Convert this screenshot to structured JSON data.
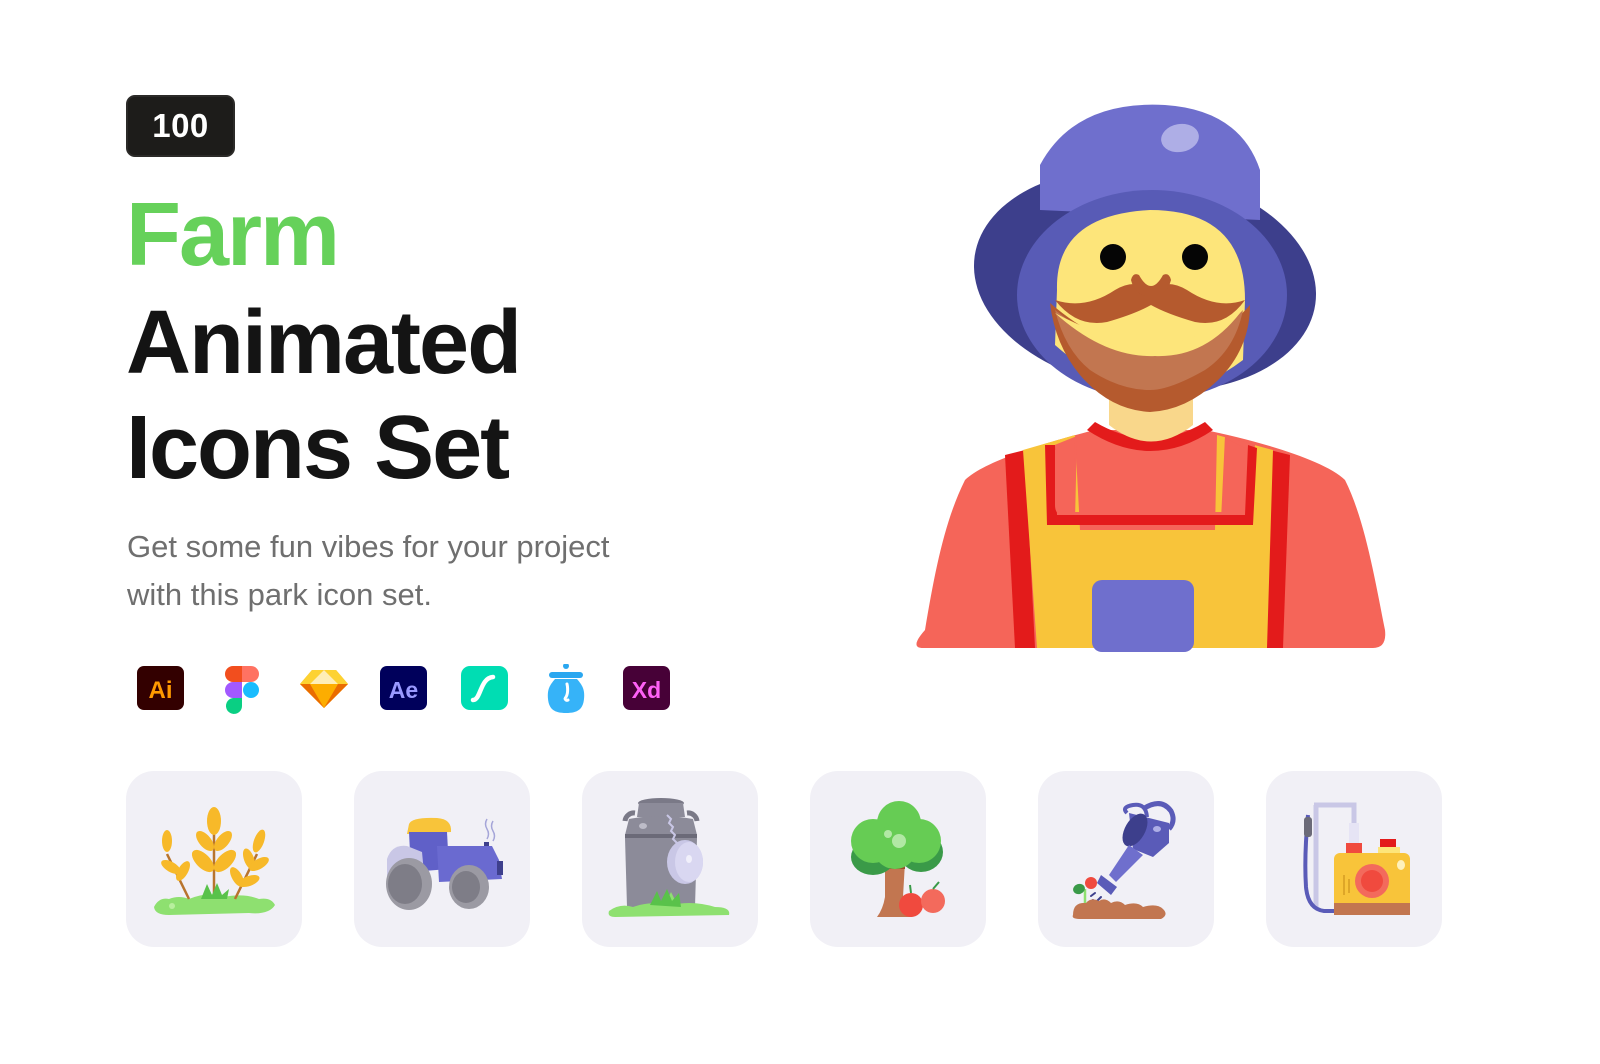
{
  "badge": {
    "count": "100"
  },
  "title": {
    "highlight": "Farm",
    "line1": "Animated",
    "line2": "Icons Set"
  },
  "subtitle": {
    "line1": "Get some fun vibes for your project",
    "line2": "with this park icon set."
  },
  "colors": {
    "accent_green": "#66d15a",
    "heading_dark": "#141414",
    "subtitle_gray": "#6f6f6f",
    "tile_bg": "#f1f0f6"
  },
  "tools": [
    {
      "name": "illustrator-icon",
      "label": "Ai"
    },
    {
      "name": "figma-icon",
      "label": ""
    },
    {
      "name": "sketch-icon",
      "label": ""
    },
    {
      "name": "after-effects-icon",
      "label": "Ae"
    },
    {
      "name": "lottie-icon",
      "label": ""
    },
    {
      "name": "iconjar-icon",
      "label": ""
    },
    {
      "name": "xd-icon",
      "label": "Xd"
    }
  ],
  "hero": {
    "icon": "farmer-icon"
  },
  "preview_icons": [
    {
      "icon": "wheat-icon"
    },
    {
      "icon": "tractor-icon"
    },
    {
      "icon": "milk-can-icon"
    },
    {
      "icon": "apple-tree-icon"
    },
    {
      "icon": "watering-can-icon"
    },
    {
      "icon": "sprayer-icon"
    }
  ]
}
